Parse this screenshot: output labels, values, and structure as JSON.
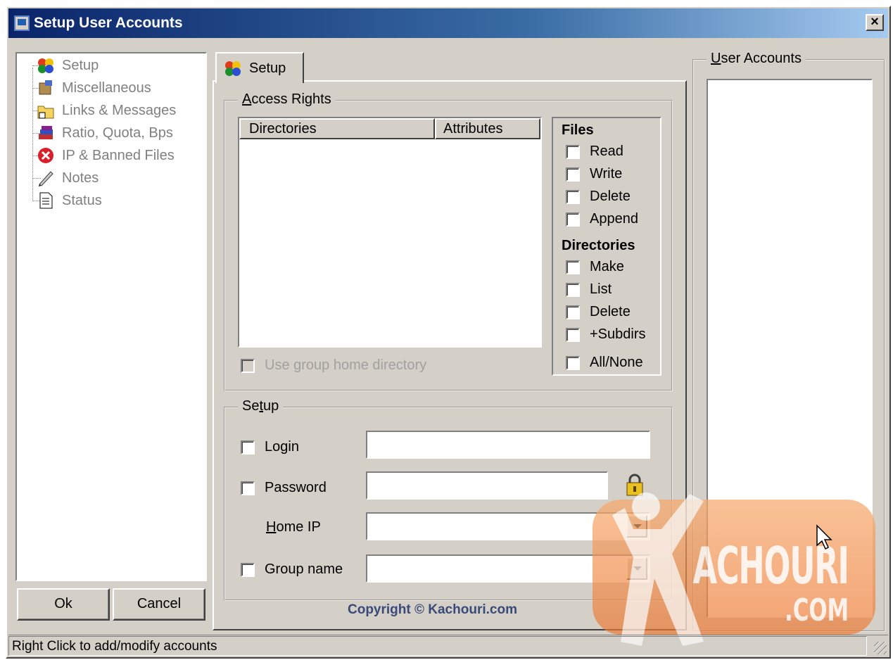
{
  "window": {
    "title": "Setup User Accounts",
    "close_label": "×"
  },
  "tree": {
    "items": [
      {
        "label": "Setup",
        "icon": "colored-shapes-icon"
      },
      {
        "label": "Miscellaneous",
        "icon": "tools-icon"
      },
      {
        "label": "Links & Messages",
        "icon": "folder-link-icon"
      },
      {
        "label": "Ratio, Quota, Bps",
        "icon": "books-icon"
      },
      {
        "label": "IP & Banned Files",
        "icon": "red-x-icon"
      },
      {
        "label": "Notes",
        "icon": "pen-icon"
      },
      {
        "label": "Status",
        "icon": "document-icon"
      }
    ]
  },
  "buttons": {
    "ok": "Ok",
    "cancel": "Cancel"
  },
  "tab": {
    "label": "Setup"
  },
  "access_rights": {
    "legend_prefix": "A",
    "legend_rest": "ccess Rights",
    "columns": [
      "Directories",
      "Attributes"
    ],
    "use_group_home": "Use group home directory"
  },
  "files": {
    "heading": "Files",
    "options": [
      "Read",
      "Write",
      "Delete",
      "Append"
    ]
  },
  "directories": {
    "heading": "Directories",
    "options": [
      "Make",
      "List",
      "Delete",
      "+Subdirs"
    ],
    "all_none": "All/None"
  },
  "setup": {
    "legend_a": "Se",
    "legend_u": "t",
    "legend_b": "up",
    "login_label": "Login",
    "login_value": "",
    "password_label": "Password",
    "password_value": "",
    "home_ip_u": "H",
    "home_ip_rest": "ome IP",
    "home_ip_value": "",
    "group_label": "Group name",
    "group_value": "",
    "copyright": "Copyright © Kachouri.com"
  },
  "user_accounts": {
    "legend_u": "U",
    "legend_rest": "ser Accounts"
  },
  "status": {
    "text": "Right Click to add/modify accounts"
  },
  "watermark": {
    "text": "ACHOURI",
    "com": ".COM"
  },
  "colors": {
    "title_start": "#0a246a",
    "title_end": "#a6caf0",
    "face": "#d4d0c8",
    "copyright": "#3a4a78",
    "watermark": "#ec7832"
  }
}
